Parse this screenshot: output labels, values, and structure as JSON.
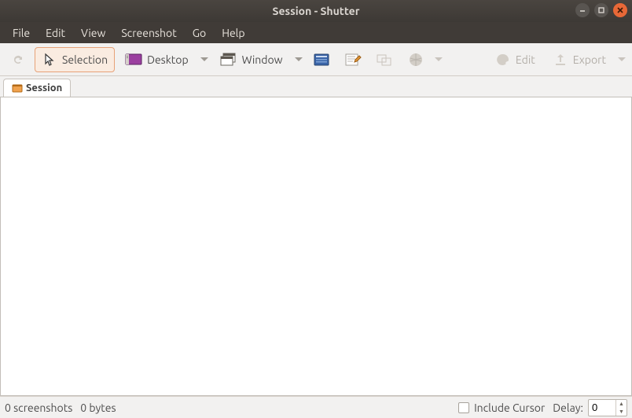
{
  "window": {
    "title": "Session - Shutter"
  },
  "menubar": {
    "items": [
      "File",
      "Edit",
      "View",
      "Screenshot",
      "Go",
      "Help"
    ]
  },
  "toolbar": {
    "redo_label": "",
    "selection_label": "Selection",
    "desktop_label": "Desktop",
    "window_label": "Window",
    "edit_label": "Edit",
    "export_label": "Export"
  },
  "tabs": {
    "session_label": "Session"
  },
  "status": {
    "screenshot_count": "0 screenshots",
    "bytes": "0 bytes",
    "include_cursor_label": "Include Cursor",
    "delay_label": "Delay:",
    "delay_value": "0"
  },
  "colors": {
    "accent_orange": "#e86837"
  }
}
